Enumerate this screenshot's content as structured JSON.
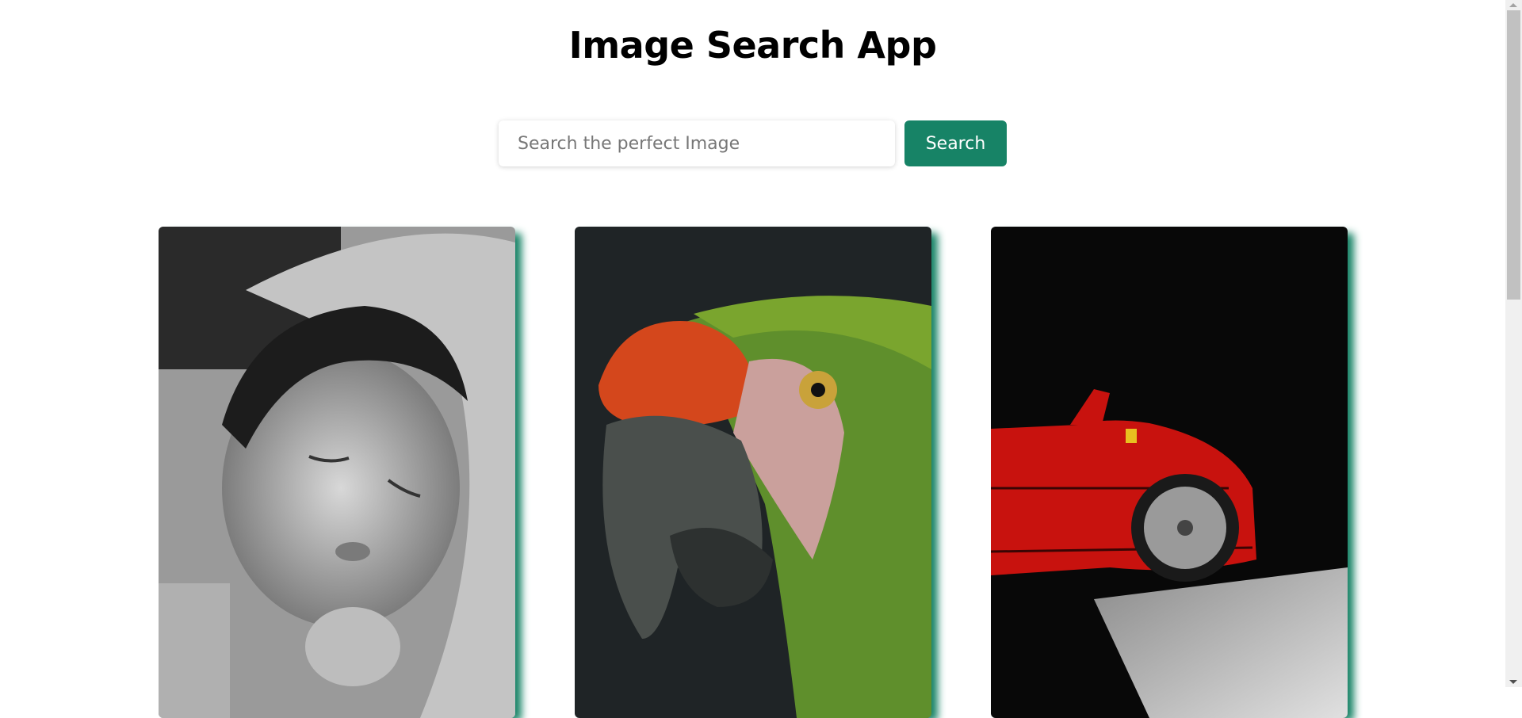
{
  "header": {
    "title": "Image Search App"
  },
  "search": {
    "placeholder": "Search the perfect Image",
    "value": "",
    "button_label": "Search"
  },
  "colors": {
    "accent": "#178366"
  },
  "results": [
    {
      "subject": "sleeping-baby-photo"
    },
    {
      "subject": "parrot-photo"
    },
    {
      "subject": "red-sports-car-photo"
    }
  ]
}
